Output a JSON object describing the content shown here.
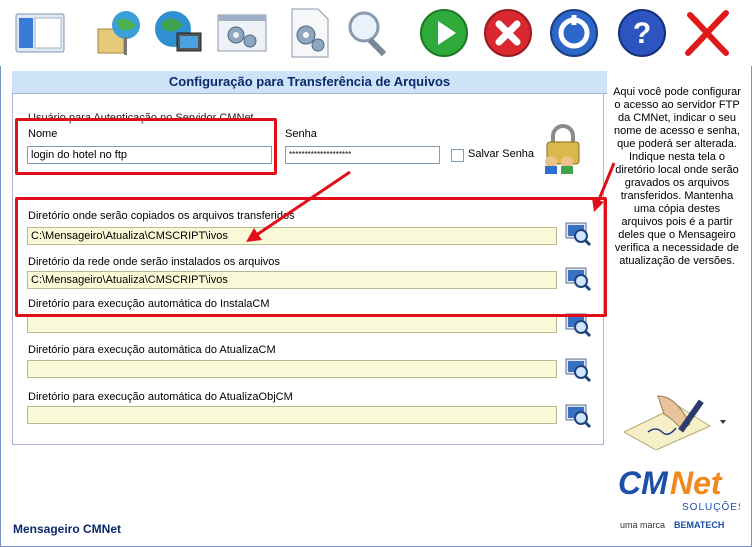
{
  "form": {
    "title": "Configuração para Transferência de Arquivos",
    "auth_group_label": "Usuário para Autenticação no Servidor CMNet",
    "name_label": "Nome",
    "name_value": "login do hotel no ftp",
    "password_label": "Senha",
    "password_value": "********************",
    "save_password_label": "Salvar Senha",
    "dirs": [
      {
        "label": "Diretório onde serão copiados os arquivos transferidos",
        "value": "C:\\Mensageiro\\Atualiza\\CMSCRIPT\\ivos"
      },
      {
        "label": "Diretório da rede onde serão instalados os arquivos",
        "value": "C:\\Mensageiro\\Atualiza\\CMSCRIPT\\ivos"
      },
      {
        "label": "Diretório para execução automática do InstalaCM",
        "value": ""
      },
      {
        "label": "Diretório para execução automática do AtualizaCM",
        "value": ""
      },
      {
        "label": "Diretório para execução automática do AtualizaObjCM",
        "value": ""
      }
    ]
  },
  "side_help": "Aqui você pode configurar o acesso ao servidor FTP da CMNet, indicar o seu nome de acesso e senha, que poderá ser alterada. Indique nesta tela o diretório local onde serão gravados os arquivos transferidos. Mantenha uma cópia destes arquivos pois é a partir deles que o Mensageiro verifica a necessidade de atualização de versões.",
  "footer": "Mensageiro CMNet",
  "logo": {
    "text_cm": "CM",
    "text_net": "Net",
    "sub": "SOLUÇÕES",
    "tag": "uma marca",
    "brand": "BEMATECH"
  },
  "colors": {
    "accent": "#0a2a6a",
    "highlight": "#e0101a",
    "title_bg": "#cfe3f8"
  }
}
